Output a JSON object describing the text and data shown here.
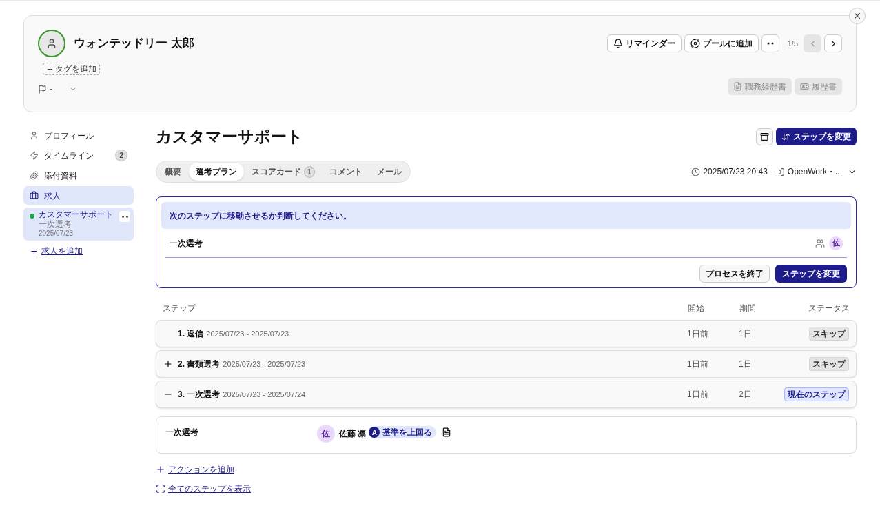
{
  "header": {
    "name": "ウォンテッドリー 太郎",
    "tag_button": "タグを追加",
    "flag_value": "-",
    "actions": [
      {
        "kind": "bell",
        "label": "リマインダー"
      },
      {
        "kind": "pool",
        "label": "プールに追加"
      }
    ],
    "pager": "1/5",
    "prev_disabled": true,
    "next_disabled": false,
    "documents": [
      {
        "kind": "doc",
        "label": "職務経歴書",
        "disabled": true
      },
      {
        "kind": "card",
        "label": "履歴書",
        "disabled": true
      }
    ]
  },
  "sidebar": {
    "items": [
      {
        "kind": "user",
        "label": "プロフィール",
        "selected": false
      },
      {
        "kind": "bolt",
        "label": "タイムライン",
        "badge": "2",
        "selected": false
      },
      {
        "kind": "clip",
        "label": "添付資料",
        "selected": false
      },
      {
        "kind": "briefcase",
        "label": "求人",
        "selected": true
      }
    ],
    "job": {
      "title": "カスタマーサポート",
      "step": "一次選考",
      "date": "2025/07/23",
      "color": "#16a34a",
      "selected": true
    },
    "add_job": "求人を追加"
  },
  "main": {
    "title": "カスタマーサポート",
    "change_step": "ステップを変更",
    "tabs": [
      {
        "label": "概要",
        "selected": false
      },
      {
        "label": "選考プラン",
        "selected": true
      },
      {
        "label": "スコアカード",
        "badge": "1",
        "selected": false
      },
      {
        "label": "コメント",
        "selected": false
      },
      {
        "label": "メール",
        "selected": false
      }
    ],
    "datetime": "2025/07/23 20:43",
    "source": "OpenWork・...",
    "notice": {
      "message": "次のステップに移動させるか判断してください。",
      "step_name": "一次選考",
      "assignee": "佐",
      "end_button": "プロセスを終了",
      "change_button": "ステップを変更"
    },
    "steps": {
      "columns": [
        "ステップ",
        "開始",
        "期間",
        "ステータス"
      ],
      "rows": [
        {
          "expandable": false,
          "title": "1. 返信",
          "dates": "2025/07/23 - 2025/07/23",
          "start": "1日前",
          "duration": "1日",
          "status": "スキップ",
          "current": false
        },
        {
          "expandable": true,
          "expanded": false,
          "title": "2. 書類選考",
          "dates": "2025/07/23 - 2025/07/23",
          "start": "1日前",
          "duration": "1日",
          "status": "スキップ",
          "current": false
        },
        {
          "expandable": true,
          "expanded": true,
          "title": "3. 一次選考",
          "dates": "2025/07/23 - 2025/07/24",
          "start": "1日前",
          "duration": "2日",
          "status": "現在のステップ",
          "current": true
        }
      ]
    },
    "detail": {
      "step_name": "一次選考",
      "avatar": "佐",
      "evaluator": "佐藤 凛",
      "grade": "A",
      "grade_label": "基準を上回る"
    },
    "add_action": "アクションを追加",
    "show_all": "全てのステップを表示"
  }
}
